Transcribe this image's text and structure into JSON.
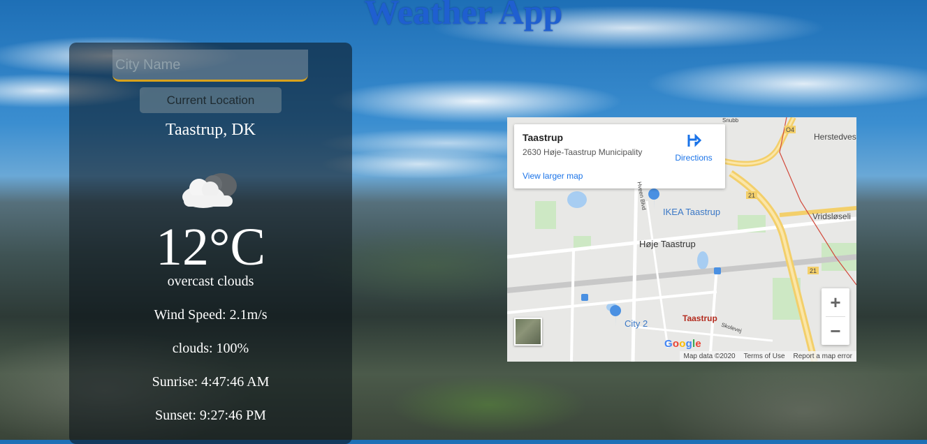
{
  "app": {
    "title": "Weather App"
  },
  "search": {
    "placeholder": "City Name",
    "value": ""
  },
  "current_location_label": "Current Location",
  "weather": {
    "location": "Taastrup, DK",
    "icon": "overcast-clouds-icon",
    "temperature": "12°C",
    "description": "overcast clouds",
    "wind": "Wind Speed: 2.1m/s",
    "clouds": "clouds: 100%",
    "sunrise": "Sunrise: 4:47:46 AM",
    "sunset": "Sunset: 9:27:46 PM"
  },
  "map": {
    "card": {
      "place": "Taastrup",
      "address": "2630 Høje-Taastrup Municipality",
      "directions": "Directions",
      "view_larger": "View larger map"
    },
    "labels": {
      "ikea": "IKEA Taastrup",
      "hoje": "Høje Taastrup",
      "city2": "City 2",
      "taastrup": "Taastrup",
      "herstedvester": "Herstedves",
      "vridslose": "Vridsløseli",
      "road_o4": "O4",
      "road_21a": "21",
      "road_21b": "21",
      "hveen": "Hveen Blvd",
      "skolevej": "Skolevej",
      "snubbe": "Snubb"
    },
    "zoom_in": "+",
    "zoom_out": "−",
    "logo": "Google",
    "attribution": {
      "data": "Map data ©2020",
      "terms": "Terms of Use",
      "report": "Report a map error"
    }
  }
}
